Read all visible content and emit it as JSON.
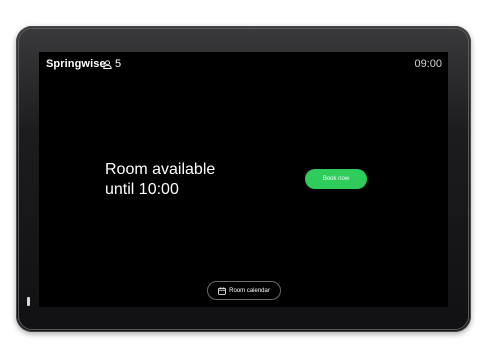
{
  "header": {
    "brand": "Springwise",
    "occupancy_count": "5",
    "occupancy_icon": "person-icon",
    "time": "09:00"
  },
  "status": {
    "line1": "Room available",
    "line2": "until 10:00"
  },
  "actions": {
    "book_label": "Book now",
    "calendar_label": "Room calendar",
    "calendar_icon": "calendar-icon"
  },
  "colors": {
    "screen_bg": "#000000",
    "book_button": "#2fcb5b",
    "text": "#ffffff"
  }
}
